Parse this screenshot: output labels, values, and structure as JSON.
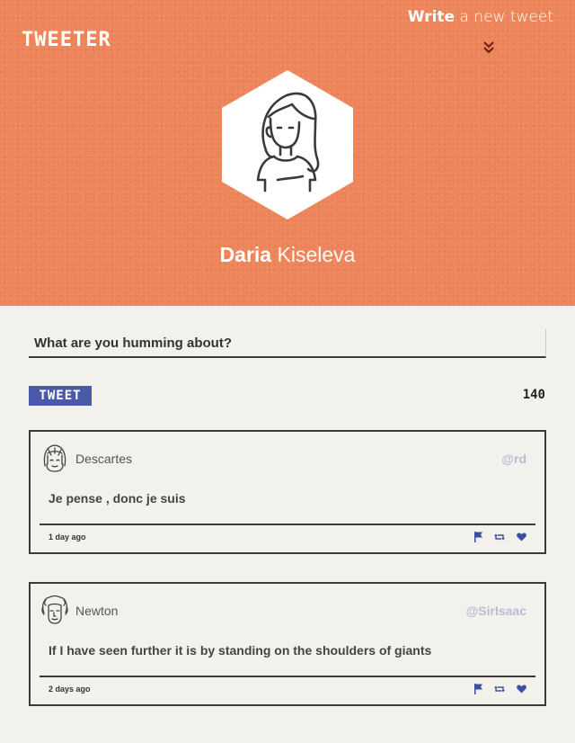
{
  "header": {
    "logo": "TWEETER",
    "write_bold": "Write",
    "write_rest": " a new tweet"
  },
  "user": {
    "first_name": "Daria",
    "last_name": "Kiseleva"
  },
  "compose": {
    "placeholder": "What are you humming about?",
    "button_label": "TWEET",
    "char_count": "140"
  },
  "colors": {
    "header_bg": "#ee855a",
    "accent": "#4b5aa8",
    "handle": "#b8bdd6"
  },
  "tweets": [
    {
      "author": "Descartes",
      "handle": "@rd",
      "text": "Je pense , donc je suis",
      "time": "1 day ago",
      "avatar_icon": "descartes-avatar-icon"
    },
    {
      "author": "Newton",
      "handle": "@SirIsaac",
      "text": "If I have seen further it is by standing on the shoulders of giants",
      "time": "2 days ago",
      "avatar_icon": "newton-avatar-icon"
    }
  ],
  "icons": {
    "flag": "flag-icon",
    "retweet": "retweet-icon",
    "like": "heart-icon"
  }
}
